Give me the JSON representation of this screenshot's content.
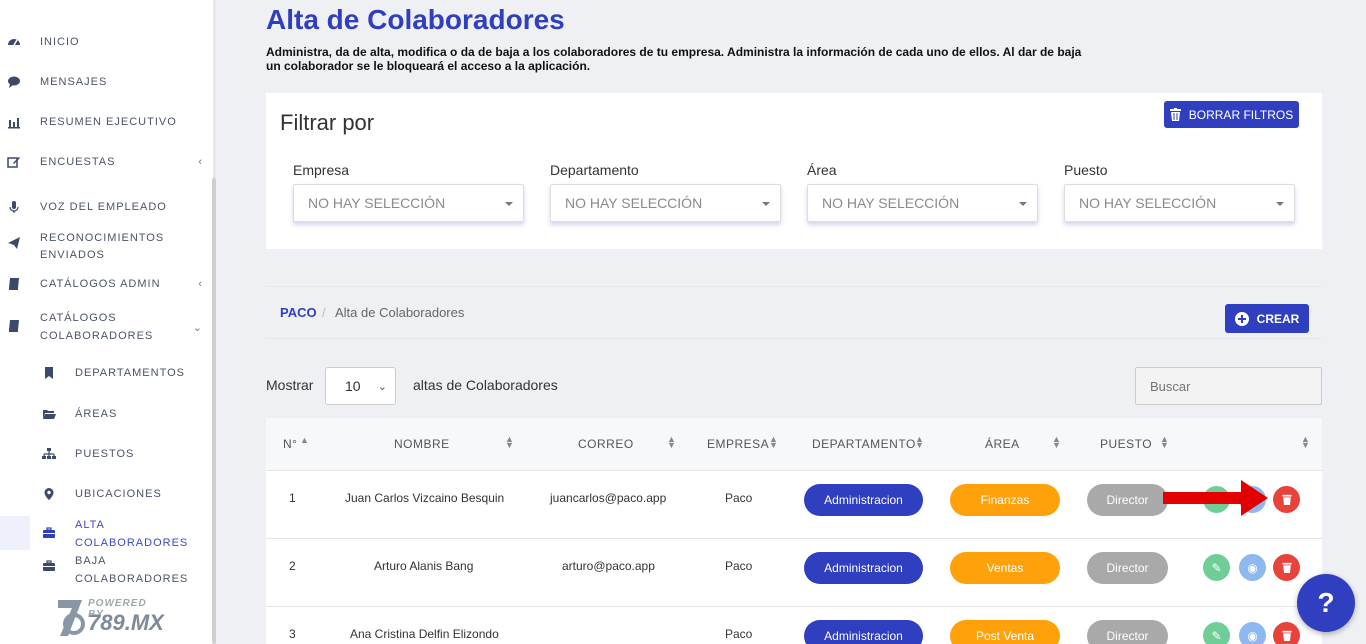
{
  "sidebar": {
    "items": [
      {
        "label": "INICIO",
        "icon": "dashboard-icon"
      },
      {
        "label": "MENSAJES",
        "icon": "chat-bubble-icon"
      },
      {
        "label": "RESUMEN EJECUTIVO",
        "icon": "bar-chart-icon"
      },
      {
        "label": "ENCUESTAS",
        "icon": "edit-icon"
      },
      {
        "label": "VOZ DEL EMPLEADO",
        "icon": "microphone-icon"
      },
      {
        "label_line1": "RECONOCIMIENTOS",
        "label_line2": "ENVIADOS",
        "icon": "paper-plane-icon"
      },
      {
        "label": "CATÁLOGOS ADMIN",
        "icon": "book-icon"
      },
      {
        "label_line1": "CATÁLOGOS",
        "label_line2": "COLABORADORES",
        "icon": "book-icon"
      }
    ],
    "subitems": [
      {
        "label": "DEPARTAMENTOS",
        "icon": "bookmark-icon"
      },
      {
        "label": "ÁREAS",
        "icon": "folder-open-icon"
      },
      {
        "label": "PUESTOS",
        "icon": "sitemap-icon"
      },
      {
        "label": "UBICACIONES",
        "icon": "map-marker-icon"
      },
      {
        "label_line1": "ALTA",
        "label_line2": "COLABORADORES",
        "icon": "briefcase-icon"
      },
      {
        "label_line1": "BAJA",
        "label_line2": "COLABORADORES",
        "icon": "briefcase-icon"
      }
    ],
    "powered": {
      "top": "POWERED BY",
      "brand": "789.MX"
    }
  },
  "header": {
    "title": "Alta de Colaboradores",
    "description": "Administra, da de alta, modifica o da de baja a los colaboradores de tu empresa. Administra la información de cada uno de ellos. Al dar de baja un colaborador se le bloqueará el acceso a la aplicación."
  },
  "filters": {
    "title": "Filtrar por",
    "clear_label": "BORRAR FILTROS",
    "groups": [
      {
        "label": "Empresa",
        "value": "NO HAY SELECCIÓN"
      },
      {
        "label": "Departamento",
        "value": "NO HAY SELECCIÓN"
      },
      {
        "label": "Área",
        "value": "NO HAY SELECCIÓN"
      },
      {
        "label": "Puesto",
        "value": "NO HAY SELECCIÓN"
      }
    ]
  },
  "breadcrumb": {
    "root": "PACO",
    "sep": "/",
    "current": "Alta de Colaboradores"
  },
  "create_label": "CREAR",
  "list_controls": {
    "show_label": "Mostrar",
    "page_size": "10",
    "suffix": "altas de Colaboradores",
    "search_placeholder": "Buscar"
  },
  "table": {
    "headers": [
      "N°",
      "NOMBRE",
      "CORREO",
      "EMPRESA",
      "DEPARTAMENTO",
      "ÁREA",
      "PUESTO"
    ],
    "rows": [
      {
        "n": "1",
        "nombre": "Juan Carlos Vizcaino Besquin",
        "correo": "juancarlos@paco.app",
        "empresa": "Paco",
        "departamento": "Administracion",
        "area": "Finanzas",
        "puesto": "Director"
      },
      {
        "n": "2",
        "nombre": "Arturo Alanis Bang",
        "correo": "arturo@paco.app",
        "empresa": "Paco",
        "departamento": "Administracion",
        "area": "Ventas",
        "puesto": "Director"
      },
      {
        "n": "3",
        "nombre": "Ana Cristina Delfin Elizondo",
        "correo": "",
        "empresa": "Paco",
        "departamento": "Administracion",
        "area": "Post Venta",
        "puesto": "Director"
      }
    ]
  },
  "help_label": "?",
  "colors": {
    "primary": "#2f3fc0",
    "area": "#ffa10a",
    "position": "#a9a9a9",
    "edit": "#6fce95",
    "view": "#8db8f0",
    "delete": "#e8433a",
    "annotation_arrow": "#e30000"
  }
}
